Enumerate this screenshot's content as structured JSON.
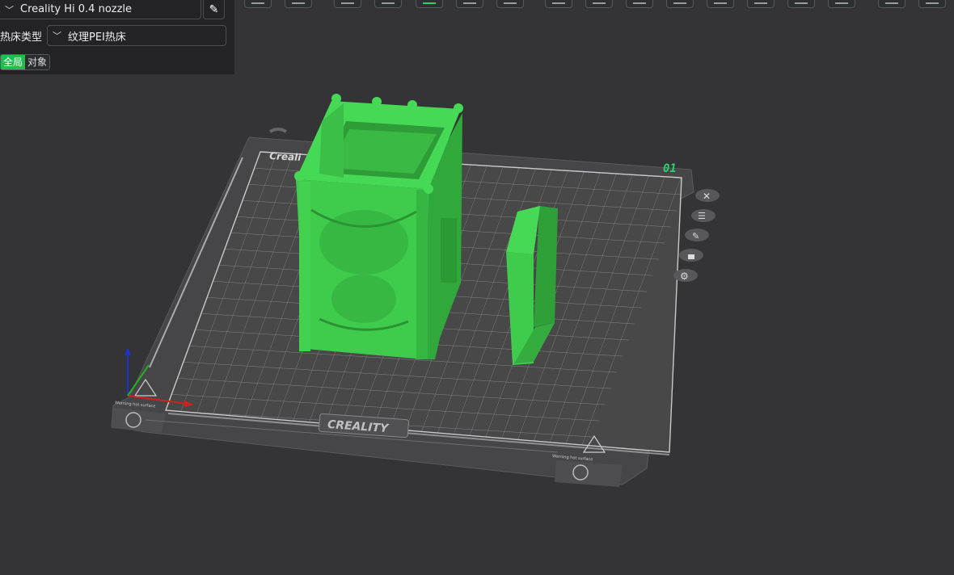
{
  "printer": {
    "name": "Creality Hi 0.4 nozzle"
  },
  "bed": {
    "label": "热床类型",
    "value": "纹理PEI热床"
  },
  "mode_toggle": {
    "global": "全局",
    "object": "对象"
  },
  "plate": {
    "number": "01",
    "brand": "CREALITY",
    "brand_partial": "Creali",
    "warning": "Warning hot surface"
  },
  "icons": {
    "toolbar": [
      "add-object-icon",
      "plate-icon",
      "cube-icon",
      "cube-icon",
      "arrange-icon",
      "layout-icon",
      "split-icon",
      "cut-icon",
      "support-icon",
      "paint-icon",
      "seam-icon",
      "mesh-icon",
      "measure-icon",
      "text-icon",
      "scale-icon",
      "more-icon"
    ],
    "plate_side": [
      "close-icon",
      "list-icon",
      "edit-icon",
      "lock-icon",
      "settings-icon"
    ]
  },
  "colors": {
    "accent": "#1fbf4f",
    "model": "#3fcc4d",
    "background": "#343436",
    "panel": "#232325"
  }
}
